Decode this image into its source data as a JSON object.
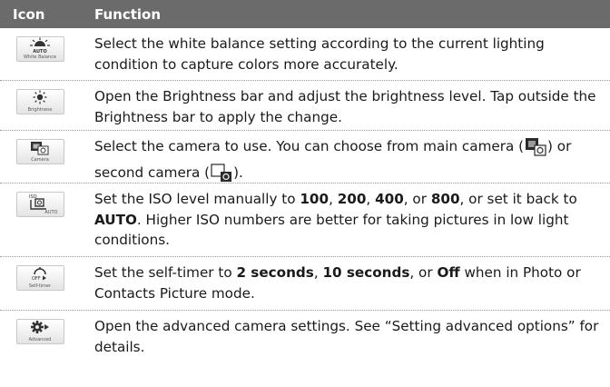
{
  "header": {
    "col_icon": "Icon",
    "col_function": "Function"
  },
  "rows": [
    {
      "icon": "white-balance-icon",
      "icon_caption": "White Balance",
      "icon_caption_top": "AUTO",
      "text": "Select the white balance setting according to the current lighting condition to capture colors more accurately."
    },
    {
      "icon": "brightness-icon",
      "icon_caption": "Brightness",
      "text": "Open the Brightness bar and adjust the brightness level. Tap outside the Brightness bar to apply the change."
    },
    {
      "icon": "camera-switch-icon",
      "icon_caption": "Camera",
      "text_a": "Select the camera to use. You can choose from main camera (",
      "text_b": ") or second camera (",
      "text_c": ")."
    },
    {
      "icon": "iso-icon",
      "icon_caption_top": "ISO",
      "icon_caption": "AUTO",
      "text_a": "Set the ISO level manually to ",
      "v1": "100",
      "sep1": ", ",
      "v2": "200",
      "sep2": ", ",
      "v3": "400",
      "sep3": ", or ",
      "v4": "800",
      "text_b": ", or set it back to ",
      "v5": "AUTO",
      "text_c": ". Higher ISO numbers are better for taking pictures in low light conditions."
    },
    {
      "icon": "self-timer-icon",
      "icon_caption_top": "OFF",
      "icon_caption": "Self-timer",
      "text_a": "Set the self-timer to ",
      "v1": "2 seconds",
      "sep1": ", ",
      "v2": "10 seconds",
      "sep2": ", or ",
      "v3": "Off",
      "text_b": " when in Photo or Contacts Picture mode."
    },
    {
      "icon": "advanced-settings-icon",
      "icon_caption": "Advanced",
      "text": "Open the advanced camera settings. See “Setting advanced options” for details."
    }
  ]
}
